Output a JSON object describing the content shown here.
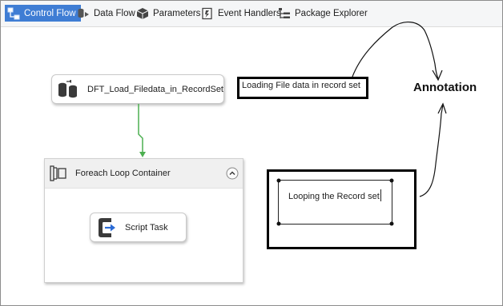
{
  "toolbar": {
    "tabs": [
      {
        "label": "Control Flow",
        "icon": "control-flow-icon",
        "active": true
      },
      {
        "label": "Data Flow",
        "icon": "data-flow-icon",
        "active": false
      },
      {
        "label": "Parameters",
        "icon": "parameters-icon",
        "active": false
      },
      {
        "label": "Event Handlers",
        "icon": "event-handlers-icon",
        "active": false
      },
      {
        "label": "Package Explorer",
        "icon": "package-explorer-icon",
        "active": false
      }
    ]
  },
  "canvas": {
    "data_flow_task": {
      "label": "DFT_Load_Filedata_in_RecordSet",
      "icon": "data-flow-task-icon"
    },
    "foreach_container": {
      "label": "Foreach Loop Container",
      "icon": "foreach-loop-icon",
      "collapse_icon": "chevron-up-icon"
    },
    "script_task": {
      "label": "Script Task",
      "icon": "script-task-icon"
    },
    "annotations": {
      "file_data": "Loading File data in record set",
      "looping": "Looping the Record set",
      "callout": "Annotation"
    }
  },
  "colors": {
    "active_tab": "#3f7dd4",
    "precedence_arrow": "#4caf50",
    "annotation_border": "#000000"
  }
}
